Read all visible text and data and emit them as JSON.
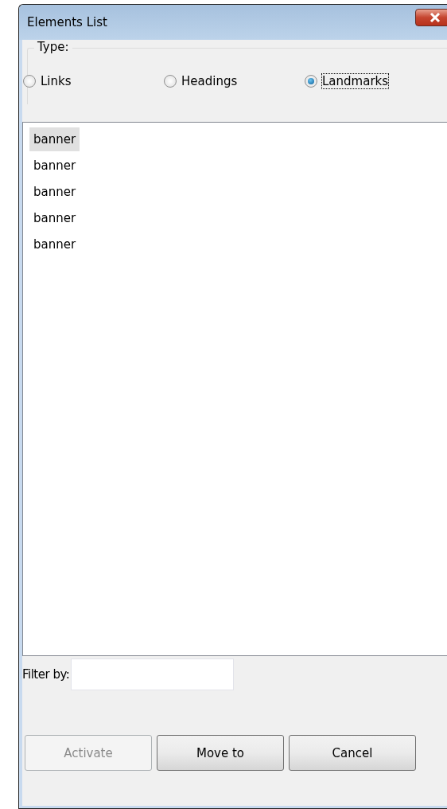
{
  "window": {
    "title": "Elements List"
  },
  "type_group": {
    "label": "Type:",
    "options": [
      {
        "label": "Links",
        "selected": false
      },
      {
        "label": "Headings",
        "selected": false
      },
      {
        "label": "Landmarks",
        "selected": true
      }
    ]
  },
  "list": {
    "items": [
      {
        "label": "banner",
        "selected": true
      },
      {
        "label": "banner",
        "selected": false
      },
      {
        "label": "banner",
        "selected": false
      },
      {
        "label": "banner",
        "selected": false
      },
      {
        "label": "banner",
        "selected": false
      }
    ]
  },
  "filter": {
    "label": "Filter by:"
  },
  "buttons": [
    {
      "label": "Activate",
      "disabled": true
    },
    {
      "label": "Move to",
      "disabled": false
    },
    {
      "label": "Cancel",
      "disabled": false
    }
  ]
}
